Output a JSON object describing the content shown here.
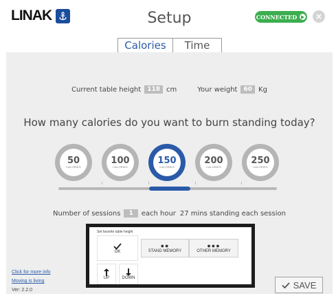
{
  "header": {
    "logo_text": "LINAK",
    "title": "Setup",
    "status": "CONNECTED",
    "status_color": "#3cae4f"
  },
  "tabs": [
    {
      "label": "Calories",
      "active": true
    },
    {
      "label": "Time",
      "active": false
    }
  ],
  "measurements": {
    "table_height_label": "Current table height",
    "table_height_value": "118",
    "table_height_unit": "cm",
    "weight_label": "Your weight",
    "weight_value": "60",
    "weight_unit": "Kg"
  },
  "question": "How many calories do you want to burn standing today?",
  "calorie_options": [
    {
      "value": "50",
      "unit": "CALORIES"
    },
    {
      "value": "100",
      "unit": "CALORIES"
    },
    {
      "value": "150",
      "unit": "CALORIES",
      "selected": true
    },
    {
      "value": "200",
      "unit": "CALORIES"
    },
    {
      "value": "250",
      "unit": "CALORIES"
    }
  ],
  "sessions": {
    "prefix": "Number of sessions",
    "value": "1",
    "suffix": "each hour",
    "detail": "27 mins standing each session"
  },
  "favorite": {
    "title": "Set favorite table height",
    "ok_label": "OK",
    "stand_memory_label": "STAND MEMORY",
    "other_memory_label": "OTHER MEMORY",
    "up_label": "UP",
    "down_label": "DOWN"
  },
  "footer": {
    "more_info_link": "Click for more info",
    "moving_link": "Moving is living",
    "version": "Ver: 2.2.0",
    "save_label": "SAVE"
  },
  "colors": {
    "accent": "#2a5aa8",
    "panel_bg": "#eeeeee"
  },
  "icons": [
    "anchor-logo-icon",
    "close-icon",
    "check-icon",
    "arrow-up-icon",
    "arrow-down-icon",
    "checkmark-save-icon"
  ]
}
